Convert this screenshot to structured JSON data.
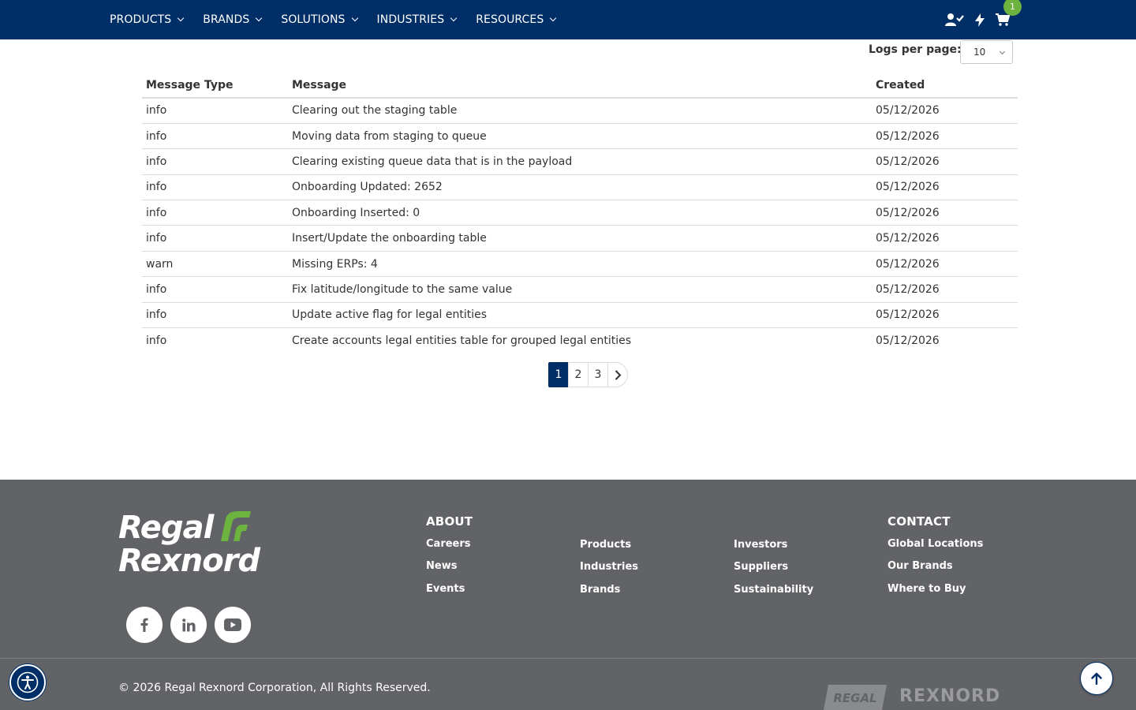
{
  "nav": {
    "items": [
      {
        "label": "PRODUCTS"
      },
      {
        "label": "BRANDS"
      },
      {
        "label": "SOLUTIONS"
      },
      {
        "label": "INDUSTRIES"
      },
      {
        "label": "RESOURCES"
      }
    ],
    "icons": [
      "user-check-icon",
      "lightning-icon",
      "cart-icon"
    ],
    "cart_count": "1"
  },
  "logs": {
    "per_page_label": "Logs per page:",
    "per_page_value": "10",
    "columns": [
      "Message Type",
      "Message",
      "Created"
    ],
    "rows": [
      {
        "type": "info",
        "message": "Clearing out the staging table",
        "created": "05/12/2026"
      },
      {
        "type": "info",
        "message": "Moving data from staging to queue",
        "created": "05/12/2026"
      },
      {
        "type": "info",
        "message": "Clearing existing queue data that is in the payload",
        "created": "05/12/2026"
      },
      {
        "type": "info",
        "message": "Onboarding Updated: 2652",
        "created": "05/12/2026"
      },
      {
        "type": "info",
        "message": "Onboarding Inserted: 0",
        "created": "05/12/2026"
      },
      {
        "type": "info",
        "message": "Insert/Update the onboarding table",
        "created": "05/12/2026"
      },
      {
        "type": "warn",
        "message": "Missing ERPs: 4",
        "created": "05/12/2026"
      },
      {
        "type": "info",
        "message": "Fix latitude/longitude to the same value",
        "created": "05/12/2026"
      },
      {
        "type": "info",
        "message": "Update active flag for legal entities",
        "created": "05/12/2026"
      },
      {
        "type": "info",
        "message": "Create accounts legal entities table for grouped legal entities",
        "created": "05/12/2026"
      }
    ],
    "pagination": {
      "pages": [
        "1",
        "2",
        "3"
      ],
      "current": "1"
    }
  },
  "footer": {
    "logo_line1": "Regal",
    "logo_line2": "Rexnord",
    "about_heading": "ABOUT",
    "contact_heading": "CONTACT",
    "col1": [
      "Careers",
      "News",
      "Events"
    ],
    "col2": [
      "Products",
      "Industries",
      "Brands"
    ],
    "col3": [
      "Investors",
      "Suppliers",
      "Sustainability"
    ],
    "col4": [
      "Global Locations",
      "Our Brands",
      "Where to Buy"
    ],
    "socials": [
      "facebook-icon",
      "linkedin-icon",
      "youtube-icon"
    ],
    "copyright": "© 2026 Regal Rexnord Corporation, All Rights Reserved.",
    "brand_regal": "REGAL",
    "brand_rexnord": "REXNORD"
  },
  "colors": {
    "nav_bg": "#002f67",
    "footer_bg": "#626366",
    "accent_green": "#6cb33f"
  }
}
